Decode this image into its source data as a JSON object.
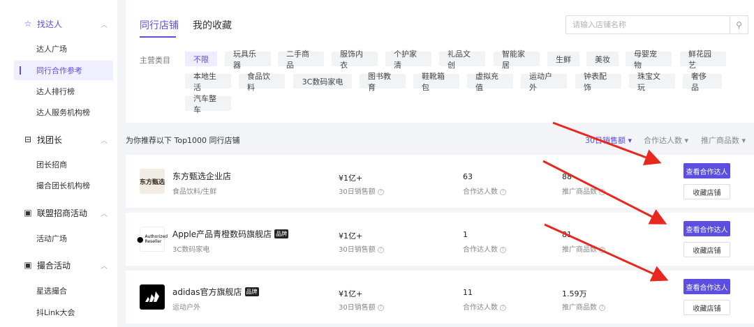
{
  "sidebar": {
    "sections": [
      {
        "label": "找达人",
        "icon": "star-outline-icon",
        "items": [
          "达人广场",
          "同行合作参考",
          "达人排行榜",
          "达人服务机构榜"
        ]
      },
      {
        "label": "找团长",
        "icon": "bag-icon",
        "items": [
          "团长招商",
          "撮合团长机构榜"
        ]
      },
      {
        "label": "联盟招商活动",
        "icon": "calendar-icon",
        "items": [
          "活动广场"
        ]
      },
      {
        "label": "撮合活动",
        "icon": "calendar-icon",
        "items": [
          "星选撮合",
          "抖Link大会"
        ]
      }
    ],
    "active_item": "同行合作参考"
  },
  "tabs": [
    "同行店铺",
    "我的收藏"
  ],
  "search": {
    "placeholder": "请输入店铺名称"
  },
  "category_label": "主营类目",
  "categories": [
    "不限",
    "玩具乐器",
    "二手商品",
    "服饰内衣",
    "个护家清",
    "礼品文创",
    "智能家居",
    "生鲜",
    "美妆",
    "母婴宠物",
    "鲜花园艺",
    "本地生活",
    "食品饮料",
    "3C数码家电",
    "图书教育",
    "鞋靴箱包",
    "虚拟充值",
    "运动户外",
    "钟表配饰",
    "珠宝文玩",
    "奢侈品",
    "汽车整车"
  ],
  "list": {
    "title": "为你推荐以下 Top1000 同行店铺",
    "sorts": [
      "30日销售额 ▾",
      "合作达人数 ▾",
      "推广商品数 ▾"
    ]
  },
  "metric_labels": {
    "sales": "30日销售额",
    "partners": "合作达人数",
    "products": "推广商品数"
  },
  "button_labels": {
    "view": "查看合作达人",
    "collect": "收藏店铺"
  },
  "shops": [
    {
      "name": "东方甄选企业店",
      "badge": "",
      "category": "食品饮料/生鲜",
      "sales": "¥1亿+",
      "partners": "63",
      "products": "88",
      "logo_text": "东方甄选"
    },
    {
      "name": "Apple产品青橙数码旗舰店",
      "badge": "品牌",
      "category": "3C数码家电",
      "sales": "¥1亿+",
      "partners": "1",
      "products": "81",
      "logo_text": "Authorized Reseller"
    },
    {
      "name": "adidas官方旗舰店",
      "badge": "品牌",
      "category": "运动户外",
      "sales": "¥1亿+",
      "partners": "11",
      "products": "1.59万",
      "logo_text": ""
    }
  ],
  "colors": {
    "accent": "#5b4ee0",
    "arrow": "#e8271e"
  }
}
